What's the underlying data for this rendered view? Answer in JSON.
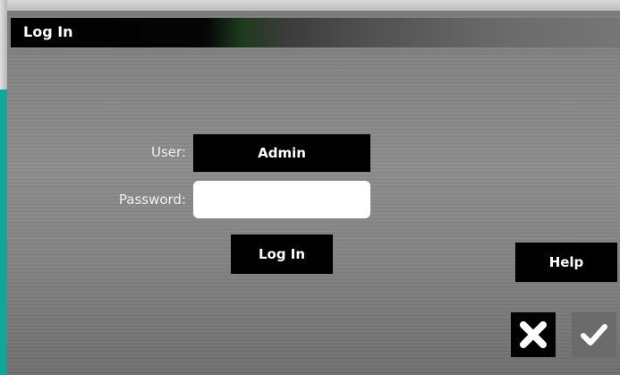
{
  "window": {
    "title": "Log In"
  },
  "form": {
    "user_label": "User:",
    "user_value": "Admin",
    "password_label": "Password:",
    "password_value": "",
    "password_placeholder": "",
    "login_button_label": "Log In"
  },
  "actions": {
    "help_label": "Help",
    "cancel_icon": "close-icon",
    "confirm_icon": "checkmark-icon"
  },
  "colors": {
    "accent_teal": "#0fa79a",
    "button_bg": "#000000",
    "button_text": "#ffffff",
    "ok_button_bg": "#6b6b6b"
  }
}
